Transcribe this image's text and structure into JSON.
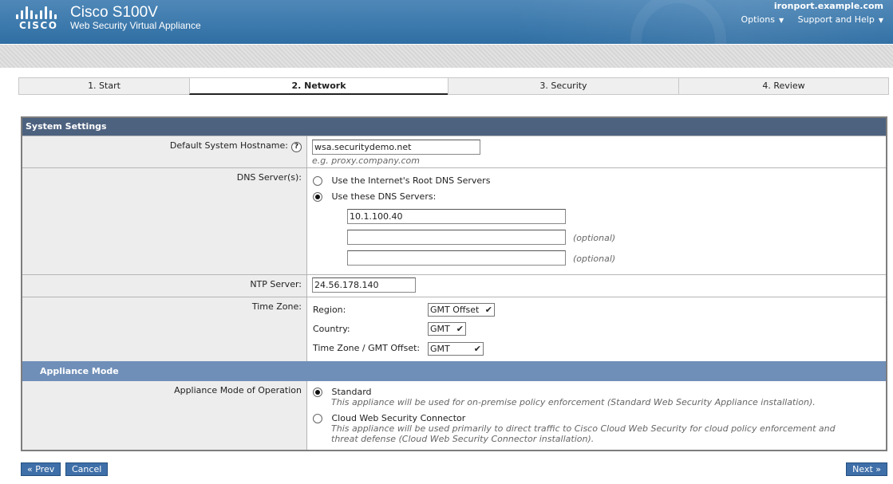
{
  "header": {
    "brand": "CISCO",
    "product_name": "Cisco S100V",
    "product_subtitle": "Web Security Virtual Appliance",
    "hostname": "ironport.example.com",
    "options_label": "Options",
    "support_label": "Support and Help"
  },
  "steps": [
    {
      "label": "1. Start",
      "active": false
    },
    {
      "label": "2. Network",
      "active": true
    },
    {
      "label": "3. Security",
      "active": false
    },
    {
      "label": "4. Review",
      "active": false
    }
  ],
  "system_settings": {
    "title": "System Settings",
    "hostname": {
      "label": "Default System Hostname:",
      "value": "wsa.securitydemo.net",
      "hint": "e.g. proxy.company.com"
    },
    "dns": {
      "label": "DNS Server(s):",
      "option_root": "Use the Internet's Root DNS Servers",
      "option_custom": "Use these DNS Servers:",
      "selected": "custom",
      "servers": [
        "10.1.100.40",
        "",
        ""
      ],
      "optional_label": "(optional)"
    },
    "ntp": {
      "label": "NTP Server:",
      "value": "24.56.178.140"
    },
    "timezone": {
      "label": "Time Zone:",
      "region_label": "Region:",
      "region_value": "GMT Offset",
      "country_label": "Country:",
      "country_value": "GMT",
      "offset_label": "Time Zone / GMT Offset:",
      "offset_value": "GMT"
    }
  },
  "appliance_mode": {
    "title": "Appliance Mode",
    "label": "Appliance Mode of Operation",
    "selected": "standard",
    "standard_title": "Standard",
    "standard_desc": "This appliance will be used for on-premise policy enforcement (Standard Web Security Appliance installation).",
    "cloud_title": "Cloud Web Security Connector",
    "cloud_desc": "This appliance will be used primarily to direct traffic to Cisco Cloud Web Security for cloud policy enforcement and threat defense (Cloud Web Security Connector installation)."
  },
  "footer": {
    "prev_label": "« Prev",
    "cancel_label": "Cancel",
    "next_label": "Next »"
  },
  "colors": {
    "header_blue": "#2f6ea3",
    "section_header": "#4d627f",
    "appliance_header": "#6f8fb8",
    "button_blue": "#3f6fa8"
  }
}
